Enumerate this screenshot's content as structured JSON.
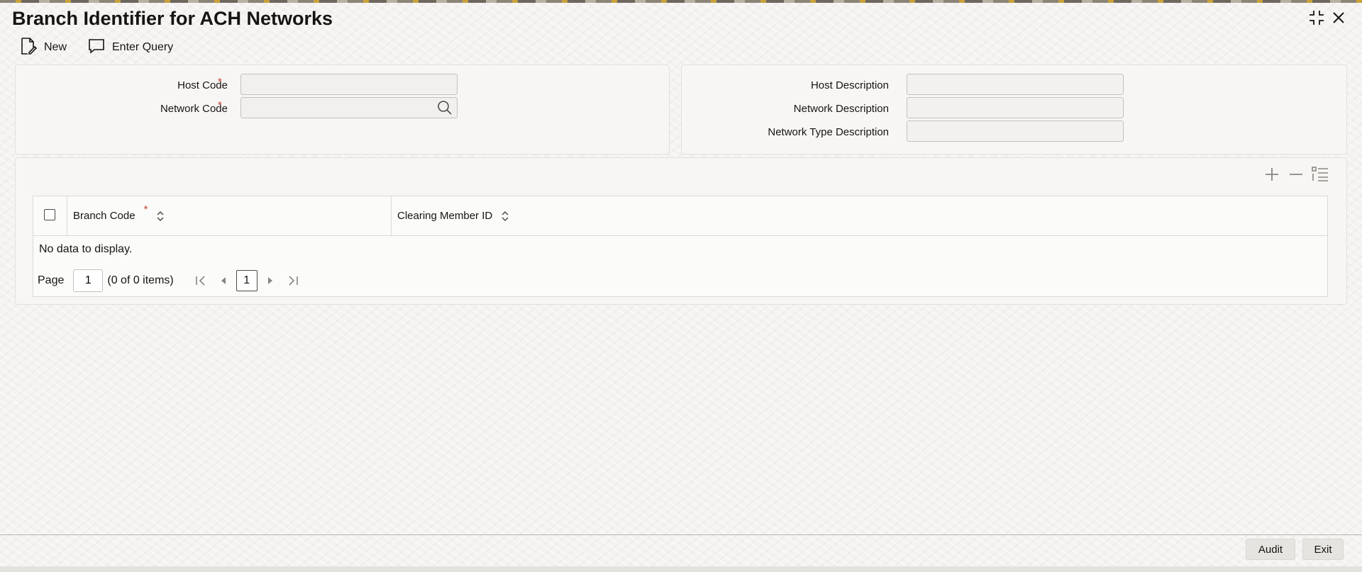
{
  "window": {
    "title": "Branch Identifier for ACH Networks"
  },
  "toolbar": {
    "new_label": "New",
    "enter_query_label": "Enter Query"
  },
  "form": {
    "host_code_label": "Host Code",
    "network_code_label": "Network Code",
    "required_mark": "*",
    "host_code_value": "",
    "network_code_value": "",
    "host_description_label": "Host Description",
    "network_description_label": "Network Description",
    "network_type_description_label": "Network Type Description",
    "host_description_value": "",
    "network_description_value": "",
    "network_type_description_value": ""
  },
  "grid": {
    "columns": [
      "Branch Code",
      "Clearing Member ID"
    ],
    "empty_text": "No data to display.",
    "page_label": "Page",
    "page_value": "1",
    "items_text": "(0 of 0 items)",
    "current_page": "1"
  },
  "footer": {
    "audit_label": "Audit",
    "exit_label": "Exit"
  },
  "colors": {
    "required": "#c74634",
    "text": "#161513"
  },
  "icons": [
    "new-document-icon",
    "chat-query-icon",
    "collapse-icon",
    "close-icon",
    "search-icon",
    "add-row-icon",
    "delete-row-icon",
    "single-view-icon",
    "sort-icon",
    "first-page-icon",
    "previous-page-icon",
    "next-page-icon",
    "last-page-icon"
  ]
}
